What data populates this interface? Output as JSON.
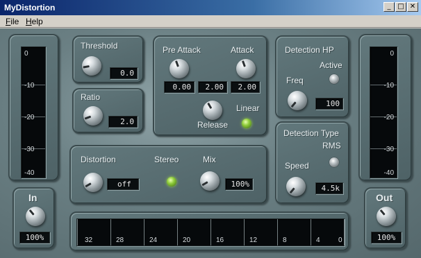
{
  "window": {
    "title": "MyDistortion",
    "controls": {
      "minimize": "_",
      "maximize": "□",
      "close": "✕"
    }
  },
  "menu": {
    "items": [
      "File",
      "Help"
    ]
  },
  "input_meter": {
    "scale": [
      "0",
      "-10",
      "-20",
      "-30",
      "-40"
    ],
    "label": "In",
    "value": "100%"
  },
  "output_meter": {
    "scale": [
      "0",
      "-10",
      "-20",
      "-30",
      "-40"
    ],
    "label": "Out",
    "value": "100%"
  },
  "threshold": {
    "label": "Threshold",
    "value": "0.0"
  },
  "ratio": {
    "label": "Ratio",
    "value": "2.0"
  },
  "envelope": {
    "pre_attack_label": "Pre Attack",
    "pre_attack_value": "0.00",
    "attack_label": "Attack",
    "attack_value_1": "2.00",
    "attack_value_2": "2.00",
    "release_label": "Release",
    "linear_label": "Linear"
  },
  "distortion": {
    "label": "Distortion",
    "value": "off",
    "stereo_label": "Stereo",
    "mix_label": "Mix",
    "mix_value": "100%"
  },
  "detection_hp": {
    "title": "Detection HP",
    "active_label": "Active",
    "freq_label": "Freq",
    "freq_value": "100"
  },
  "detection_type": {
    "title": "Detection Type",
    "mode_label": "RMS",
    "speed_label": "Speed",
    "speed_value": "4.5k"
  },
  "gain_reduction_scale": [
    "32",
    "28",
    "24",
    "20",
    "16",
    "12",
    "8",
    "4",
    "0"
  ],
  "colors": {
    "led_on": "#8fcc3a",
    "titlebar": "#0a246a",
    "panel": "#5a6f73"
  }
}
